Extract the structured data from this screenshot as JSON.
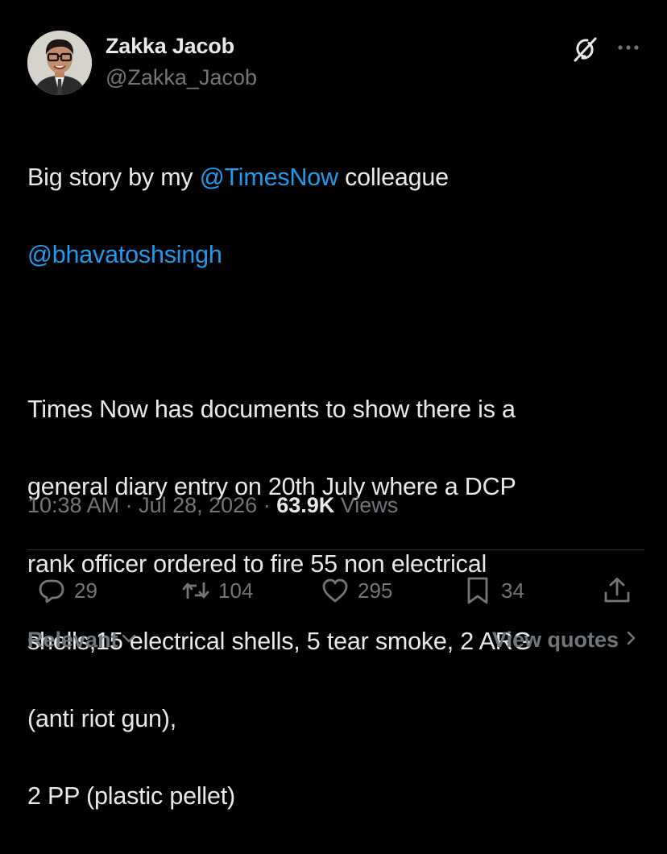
{
  "author": {
    "display_name": "Zakka Jacob",
    "handle": "@Zakka_Jacob"
  },
  "tweet": {
    "line1_prefix": "Big story by my ",
    "line1_mention": "@TimesNow",
    "line1_suffix": " colleague",
    "line2_mention": "@bhavatoshsingh",
    "paragraph_lines": [
      "Times Now has documents to show there is a",
      "general diary entry on 20th July where a DCP",
      "rank officer ordered to fire 55 non electrical",
      "shells,15 electrical shells, 5 tear smoke, 2 ARG",
      "(anti riot gun),",
      "2 PP (plastic pellet)"
    ]
  },
  "meta": {
    "time": "10:38 AM",
    "separator": " · ",
    "date": "Jul 28, 2026",
    "views_count": "63.9K",
    "views_label": " Views"
  },
  "actions": {
    "replies": "29",
    "reposts": "104",
    "likes": "295",
    "bookmarks": "34"
  },
  "footer": {
    "sort_label": "Relevant",
    "view_quotes_label": "View quotes"
  },
  "icons": {
    "grok": "grok-icon",
    "more": "more-dots-icon",
    "reply": "reply-icon",
    "repost": "repost-icon",
    "like": "heart-icon",
    "bookmark": "bookmark-icon",
    "share": "share-icon"
  },
  "colors": {
    "background": "#000000",
    "text": "#e7e9ea",
    "muted": "#71767b",
    "link": "#1d9bf0",
    "divider": "#2f3336"
  }
}
